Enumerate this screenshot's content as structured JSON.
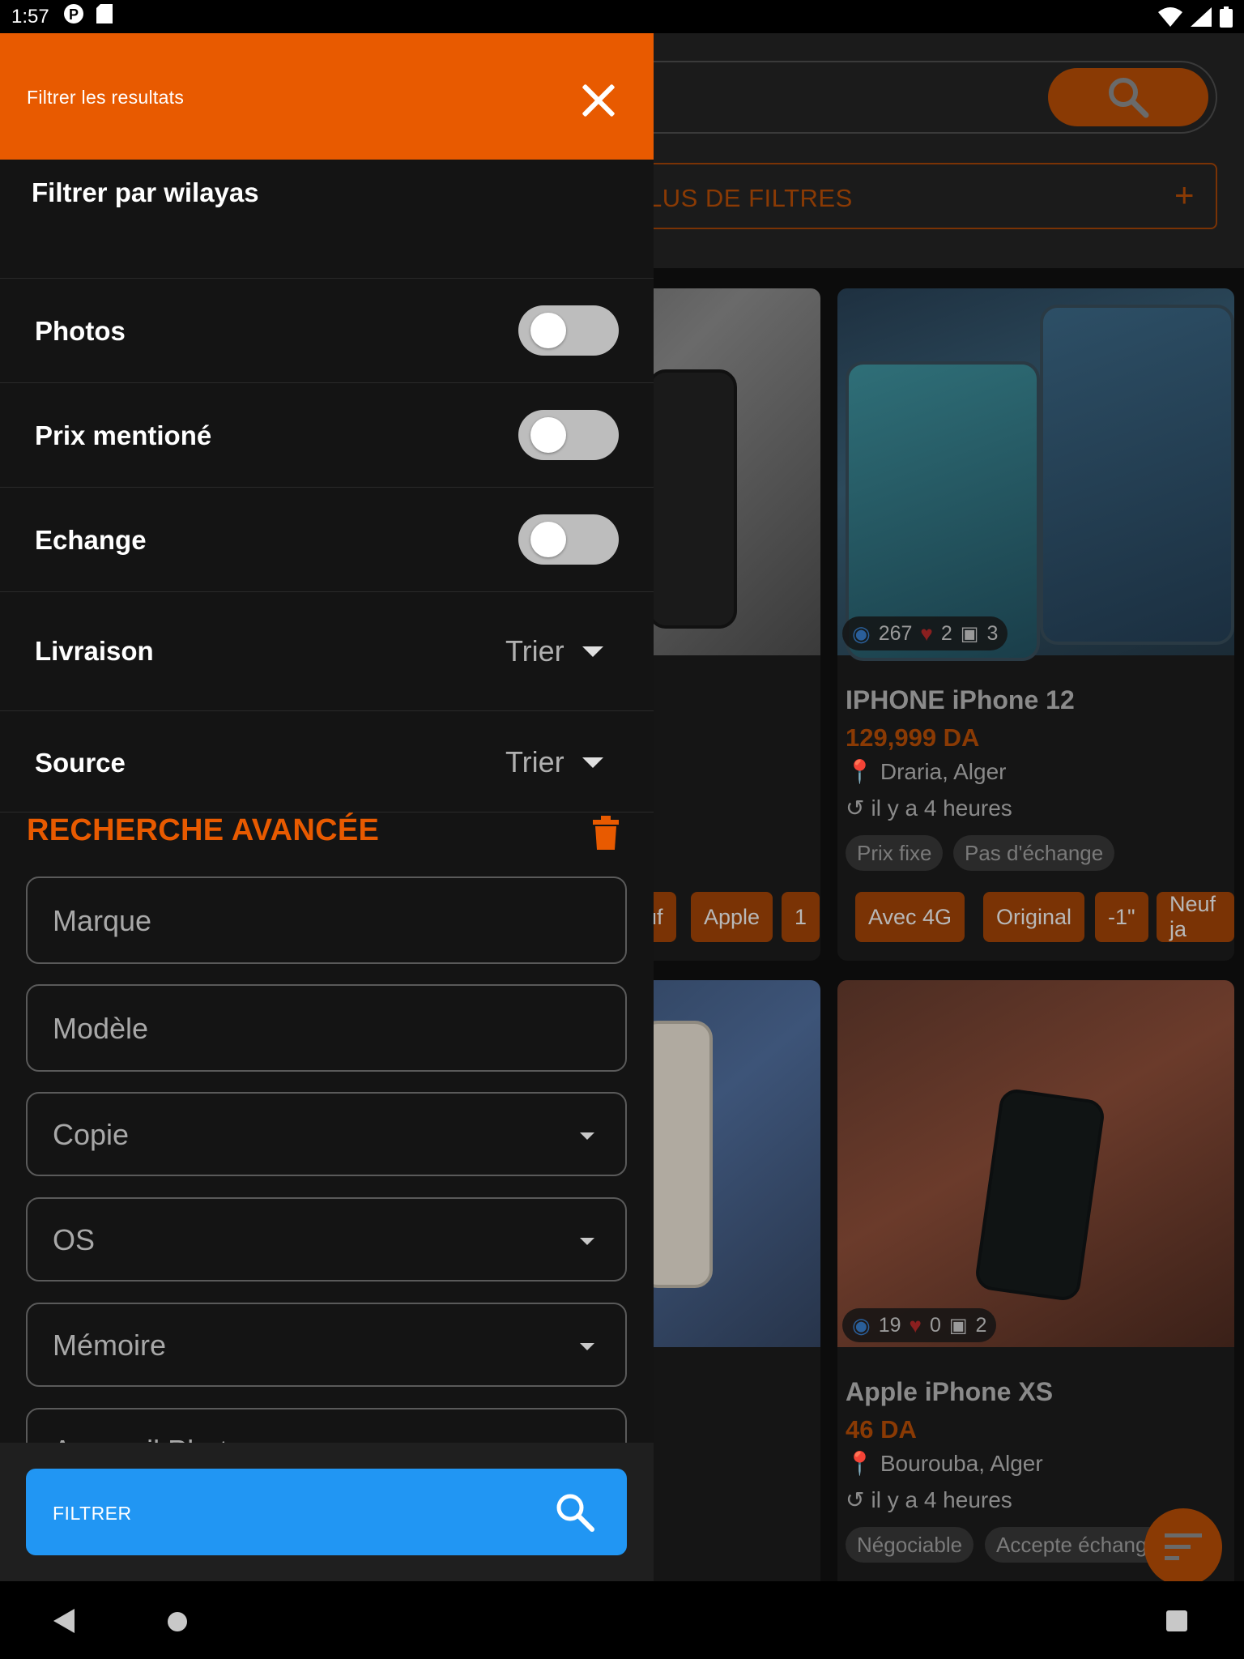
{
  "status_bar": {
    "time": "1:57"
  },
  "background": {
    "more_filters_label": "LUS DE FILTRES",
    "more_filters_plus": "+",
    "cards": [
      {
        "title": "",
        "tags": [
          "uf",
          "Apple",
          "1"
        ]
      },
      {
        "views": "267",
        "likes": "2",
        "photos": "3",
        "title": "IPHONE iPhone 12",
        "price": "129,999 DA",
        "location": "Draria, Alger",
        "time": "il y a 4 heures",
        "chips": [
          "Prix fixe",
          "Pas d'échange"
        ],
        "tags": [
          "Avec 4G",
          "Original",
          "-1\"",
          "Neuf ja"
        ]
      },
      {
        "views": "19",
        "likes": "0",
        "photos": "2",
        "title": "Apple iPhone XS",
        "price": "46 DA",
        "location": "Bourouba, Alger",
        "time": "il y a 4 heures",
        "chips": [
          "Négociable",
          "Accepte échange"
        ]
      }
    ]
  },
  "drawer": {
    "title": "Filtrer les resultats",
    "wilayas_label": "Filtrer par wilayas",
    "toggles": [
      {
        "label": "Photos",
        "on": false
      },
      {
        "label": "Prix mentioné",
        "on": false
      },
      {
        "label": "Echange",
        "on": false
      }
    ],
    "sorts": [
      {
        "label": "Livraison",
        "value": "Trier"
      },
      {
        "label": "Source",
        "value": "Trier"
      }
    ],
    "advanced": {
      "title": "RECHERCHE AVANCÉE",
      "fields": [
        {
          "placeholder": "Marque",
          "dropdown": false
        },
        {
          "placeholder": "Modèle",
          "dropdown": false
        },
        {
          "placeholder": "Copie",
          "dropdown": true
        },
        {
          "placeholder": "OS",
          "dropdown": true
        },
        {
          "placeholder": "Mémoire",
          "dropdown": true
        },
        {
          "placeholder": "Appareil Photo",
          "dropdown": false
        }
      ]
    },
    "filter_button": "FILTRER"
  },
  "colors": {
    "accent": "#e85a00",
    "button": "#2196f3",
    "background": "#141414"
  }
}
